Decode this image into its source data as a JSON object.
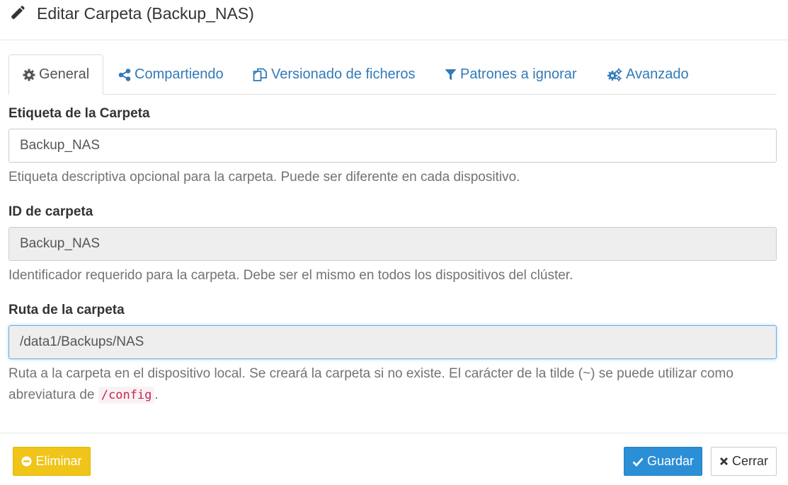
{
  "dialog": {
    "title": "Editar Carpeta (Backup_NAS)",
    "title_icon": "pencil-icon"
  },
  "tabs": [
    {
      "label": "General",
      "icon": "gear-icon",
      "active": true
    },
    {
      "label": "Compartiendo",
      "icon": "share-icon",
      "active": false
    },
    {
      "label": "Versionado de ficheros",
      "icon": "files-icon",
      "active": false
    },
    {
      "label": "Patrones a ignorar",
      "icon": "filter-icon",
      "active": false
    },
    {
      "label": "Avanzado",
      "icon": "cogs-icon",
      "active": false
    }
  ],
  "fields": {
    "label": {
      "title": "Etiqueta de la Carpeta",
      "value": "Backup_NAS",
      "help": "Etiqueta descriptiva opcional para la carpeta. Puede ser diferente en cada dispositivo."
    },
    "id": {
      "title": "ID de carpeta",
      "value": "Backup_NAS",
      "help": "Identificador requerido para la carpeta. Debe ser el mismo en todos los dispositivos del clúster."
    },
    "path": {
      "title": "Ruta de la carpeta",
      "value": "/data1/Backups/NAS",
      "help_before": "Ruta a la carpeta en el dispositivo local. Se creará la carpeta si no existe. El carácter de la tilde (~) se puede utilizar como abreviatura de ",
      "help_code": "/config",
      "help_after": "."
    }
  },
  "footer": {
    "delete_label": "Eliminar",
    "save_label": "Guardar",
    "close_label": "Cerrar"
  },
  "colors": {
    "link": "#337ab7",
    "warning": "#f0c419",
    "primary": "#2b8fd6",
    "code": "#c7254e"
  }
}
